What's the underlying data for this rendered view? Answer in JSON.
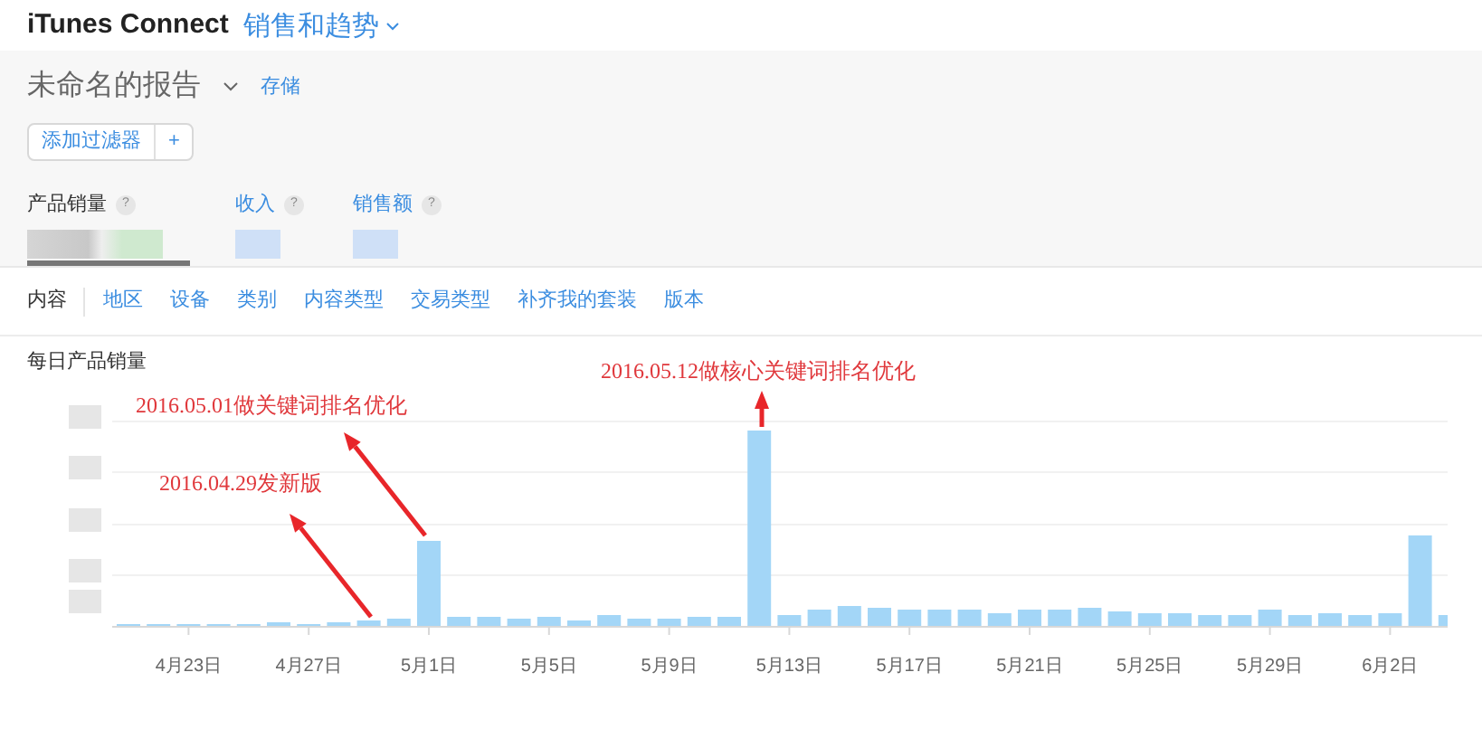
{
  "header": {
    "app_title": "iTunes Connect",
    "section": "销售和趋势"
  },
  "report": {
    "title": "未命名的报告",
    "save_link": "存储"
  },
  "filter": {
    "add_label": "添加过滤器",
    "plus": "+"
  },
  "metrics": [
    {
      "label": "产品销量",
      "help": "?",
      "selected": true
    },
    {
      "label": "收入",
      "help": "?",
      "selected": false
    },
    {
      "label": "销售额",
      "help": "?",
      "selected": false
    }
  ],
  "tabs": [
    {
      "label": "内容",
      "selected": true
    },
    {
      "label": "地区",
      "selected": false
    },
    {
      "label": "设备",
      "selected": false
    },
    {
      "label": "类别",
      "selected": false
    },
    {
      "label": "内容类型",
      "selected": false
    },
    {
      "label": "交易类型",
      "selected": false
    },
    {
      "label": "补齐我的套装",
      "selected": false
    },
    {
      "label": "版本",
      "selected": false
    }
  ],
  "chart": {
    "title": "每日产品销量",
    "x_labels": [
      "4月23日",
      "4月27日",
      "5月1日",
      "5月5日",
      "5月9日",
      "5月13日",
      "5月17日",
      "5月21日",
      "5月25日",
      "5月29日",
      "6月2日"
    ],
    "annotations": [
      "2016.05.12做核心关键词排名优化",
      "2016.05.01做关键词排名优化",
      "2016.04.29发新版"
    ]
  }
}
